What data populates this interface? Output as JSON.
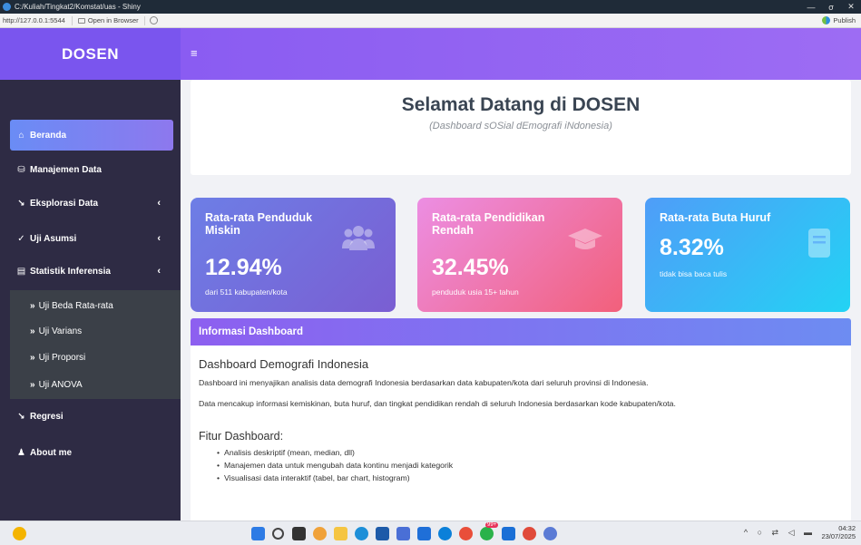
{
  "window": {
    "title": "C:/Kuliah/Tingkat2/Komstat/uas - Shiny",
    "minimize": "—",
    "maximize": "σ",
    "close": "✕"
  },
  "browser": {
    "url": "http://127.0.0.1:5544",
    "open_in_browser": "Open in Browser",
    "publish": "Publish"
  },
  "app": {
    "brand": "DOSEN",
    "hamburger": "≡"
  },
  "sidebar": {
    "items": [
      {
        "label": "Beranda",
        "icon": "⌂"
      },
      {
        "label": "Manajemen Data",
        "icon": "⛁"
      },
      {
        "label": "Eksplorasi Data",
        "icon": "↘",
        "chevron": "‹"
      },
      {
        "label": "Uji Asumsi",
        "icon": "✓",
        "chevron": "‹"
      },
      {
        "label": "Statistik Inferensia",
        "icon": "▤",
        "chevron": "‹"
      },
      {
        "label": "Regresi",
        "icon": "↘"
      },
      {
        "label": "About me",
        "icon": "♟"
      }
    ],
    "sub_items": [
      {
        "label": "Uji Beda Rata-rata"
      },
      {
        "label": "Uji Varians"
      },
      {
        "label": "Uji Proporsi"
      },
      {
        "label": "Uji ANOVA"
      }
    ],
    "sub_marker": "»"
  },
  "header": {
    "title": "Selamat Datang di DOSEN",
    "subtitle": "(Dashboard sOSial dEmografi iNdonesia)"
  },
  "stats": [
    {
      "label": "Rata-rata Penduduk Miskin",
      "value": "12.94%",
      "sub": "dari 511 kabupaten/kota",
      "icon": "users-icon",
      "colors": [
        "#6d7ee6",
        "#7a5ed2"
      ]
    },
    {
      "label": "Rata-rata Pendidikan Rendah",
      "value": "32.45%",
      "sub": "penduduk usia 15+ tahun",
      "icon": "graduation-cap-icon",
      "colors": [
        "#ec8ee3",
        "#f2607b"
      ]
    },
    {
      "label": "Rata-rata Buta Huruf",
      "value": "8.32%",
      "sub": "tidak bisa baca tulis",
      "icon": "book-icon",
      "colors": [
        "#4f9df8",
        "#23d3f4"
      ]
    }
  ],
  "info_panel": {
    "header": "Informasi Dashboard",
    "heading": "Dashboard Demografi Indonesia",
    "paragraphs": [
      "Dashboard ini menyajikan analisis data demografi Indonesia berdasarkan data kabupaten/kota dari seluruh provinsi di Indonesia.",
      "Data mencakup informasi kemiskinan, buta huruf, dan tingkat pendidikan rendah di seluruh Indonesia berdasarkan kode kabupaten/kota."
    ],
    "features_title": "Fitur Dashboard:",
    "features": [
      "Analisis deskriptif (mean, median, dll)",
      "Manajemen data untuk mengubah data kontinu menjadi kategorik",
      "Visualisasi data interaktif (tabel, bar chart, histogram)"
    ]
  },
  "taskbar": {
    "badge": "99+",
    "time": "04:32",
    "date": "23/07/2025",
    "tray": "^ ○ ⇄ ◁ ▬"
  },
  "colors": {
    "sidebar_bg": "#2e2b44",
    "brand": "#7a55ee",
    "accent": "#8a5cf2"
  }
}
